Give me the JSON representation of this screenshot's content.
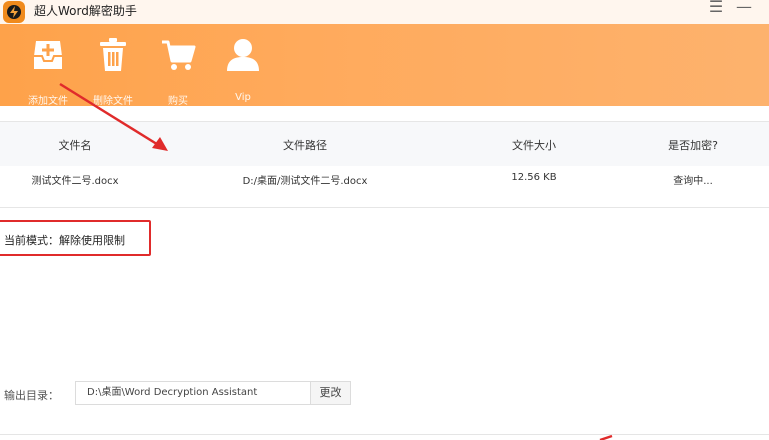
{
  "app": {
    "title": "超人Word解密助手"
  },
  "window": {
    "menu_glyph": "☰",
    "min_glyph": "—"
  },
  "toolbar": {
    "buttons": [
      {
        "label": "添加文件",
        "icon": "add-file-icon"
      },
      {
        "label": "删除文件",
        "icon": "trash-icon"
      },
      {
        "label": "购买",
        "icon": "cart-icon"
      },
      {
        "label": "Vip",
        "icon": "user-icon"
      }
    ]
  },
  "table": {
    "columns": [
      "文件名",
      "文件路径",
      "文件大小",
      "是否加密?"
    ],
    "rows": [
      {
        "name": "测试文件二号.docx",
        "path": "D:/桌面/测试文件二号.docx",
        "size": "12.56 KB",
        "status": "查询中..."
      }
    ]
  },
  "mode": {
    "text": "当前模式：解除使用限制"
  },
  "output": {
    "label": "输出目录：",
    "path": "D:\\桌面\\Word Decryption Assistant",
    "change_label": "更改"
  },
  "colors": {
    "toolbar": "#fea24a",
    "accent": "#f08a1c",
    "annotation": "#e02b2b"
  }
}
